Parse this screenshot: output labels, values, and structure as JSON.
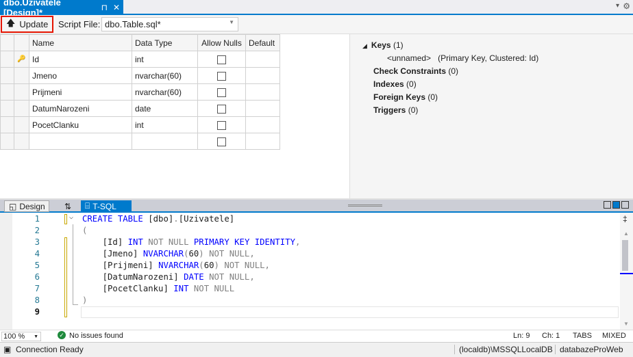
{
  "tab": {
    "title": "dbo.Uzivatele [Design]*",
    "pin": "⊓",
    "close": "✕"
  },
  "toolbar": {
    "update": "Update",
    "script_file_label": "Script File:",
    "script_file": "dbo.Table.sql*"
  },
  "grid": {
    "headers": [
      "Name",
      "Data Type",
      "Allow Nulls",
      "Default"
    ],
    "rows": [
      {
        "name": "Id",
        "type": "int",
        "key": true
      },
      {
        "name": "Jmeno",
        "type": "nvarchar(60)"
      },
      {
        "name": "Prijmeni",
        "type": "nvarchar(60)"
      },
      {
        "name": "DatumNarozeni",
        "type": "date"
      },
      {
        "name": "PocetClanku",
        "type": "int"
      },
      {
        "name": "",
        "type": ""
      }
    ]
  },
  "keys": {
    "keys": "Keys",
    "keys_count": "(1)",
    "unnamed": "<unnamed>",
    "unnamed_desc": "(Primary Key, Clustered: Id)",
    "check": "Check Constraints",
    "check_count": "(0)",
    "indexes": "Indexes",
    "indexes_count": "(0)",
    "fk": "Foreign Keys",
    "fk_count": "(0)",
    "triggers": "Triggers",
    "triggers_count": "(0)"
  },
  "bottom_tabs": {
    "design": "Design",
    "swap": "⇅",
    "tsql": "T-SQL"
  },
  "code": {
    "lines": [
      [
        [
          "kw",
          "CREATE TABLE "
        ],
        [
          "",
          "[dbo]"
        ],
        [
          "gr",
          "."
        ],
        [
          "",
          "[Uzivatele]"
        ]
      ],
      [
        [
          "gr",
          "("
        ]
      ],
      [
        [
          "",
          "    [Id] "
        ],
        [
          "kw",
          "INT "
        ],
        [
          "gr",
          "NOT NULL "
        ],
        [
          "kw",
          "PRIMARY KEY IDENTITY"
        ],
        [
          "gr",
          ","
        ]
      ],
      [
        [
          "",
          "    [Jmeno] "
        ],
        [
          "kw",
          "NVARCHAR"
        ],
        [
          "gr",
          "("
        ],
        [
          "",
          "60"
        ],
        [
          "gr",
          ") NOT NULL,"
        ]
      ],
      [
        [
          "",
          "    [Prijmeni] "
        ],
        [
          "kw",
          "NVARCHAR"
        ],
        [
          "gr",
          "("
        ],
        [
          "",
          "60"
        ],
        [
          "gr",
          ") NOT NULL,"
        ]
      ],
      [
        [
          "",
          "    [DatumNarozeni] "
        ],
        [
          "kw",
          "DATE "
        ],
        [
          "gr",
          "NOT NULL,"
        ]
      ],
      [
        [
          "",
          "    [PocetClanku] "
        ],
        [
          "kw",
          "INT "
        ],
        [
          "gr",
          "NOT NULL"
        ]
      ],
      [
        [
          "gr",
          ")"
        ]
      ],
      []
    ]
  },
  "status": {
    "zoom": "100 %",
    "issues": "No issues found",
    "ln": "Ln: 9",
    "ch": "Ch: 1",
    "tabs": "TABS",
    "eol": "MIXED"
  },
  "conn": {
    "state": "Connection Ready",
    "server": "(localdb)\\MSSQLLocalDB",
    "db": "databazeProWeb"
  }
}
